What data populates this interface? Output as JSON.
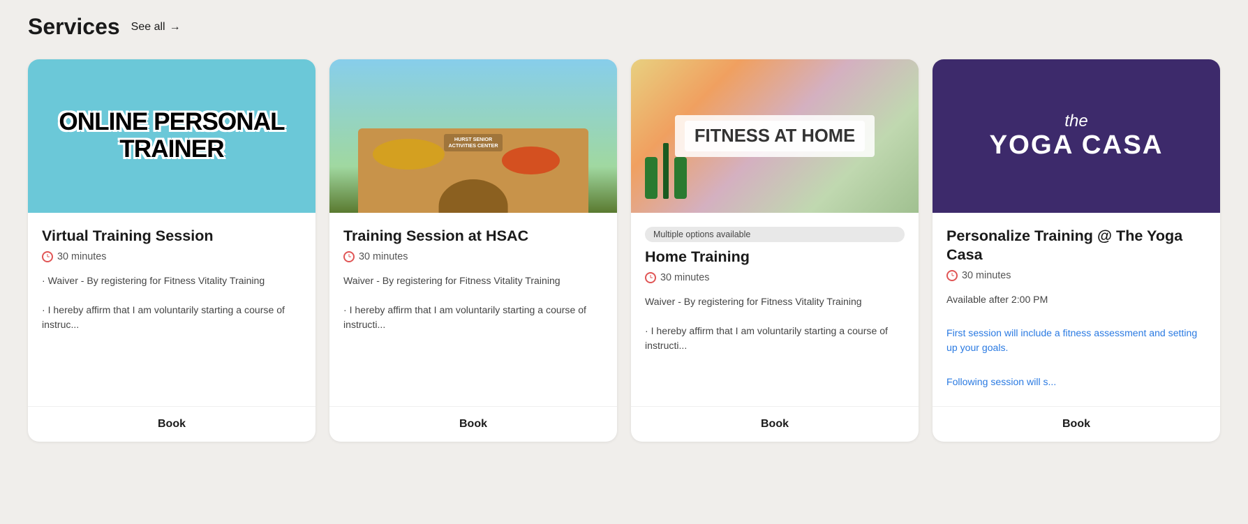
{
  "header": {
    "title": "Services",
    "see_all_label": "See all",
    "arrow": "→"
  },
  "cards": [
    {
      "id": "virtual",
      "image_type": "virtual",
      "image_alt": "Online Personal Trainer graphic",
      "image_label": "ONLINE PERSONAL TRAINER",
      "badge": null,
      "title": "Virtual Training Session",
      "duration": "30 minutes",
      "description_line1": "· Waiver - By registering for Fitness Vitality Training",
      "description_line2": "· I hereby affirm that I am voluntarily starting a course of instruc...",
      "available_note": null,
      "extra_link1": null,
      "extra_link2": null,
      "book_label": "Book"
    },
    {
      "id": "hsac",
      "image_type": "hsac",
      "image_alt": "Hurst Senior Activities Center building",
      "image_label": "",
      "badge": null,
      "title": "Training Session at HSAC",
      "duration": "30 minutes",
      "description_line1": "Waiver - By registering for Fitness Vitality Training",
      "description_line2": "· I hereby affirm that I am voluntarily starting a course of instructi...",
      "available_note": null,
      "extra_link1": null,
      "extra_link2": null,
      "book_label": "Book"
    },
    {
      "id": "home",
      "image_type": "home",
      "image_alt": "Fitness at Home equipment",
      "image_label": "FITNESS AT HOME",
      "badge": "Multiple options available",
      "title": "Home Training",
      "duration": "30 minutes",
      "description_line1": "Waiver - By registering for Fitness Vitality Training",
      "description_line2": "· I hereby affirm that I am voluntarily starting a course of instructi...",
      "available_note": null,
      "extra_link1": null,
      "extra_link2": null,
      "book_label": "Book"
    },
    {
      "id": "yoga",
      "image_type": "yoga",
      "image_alt": "The Yoga Casa sign",
      "image_label_the": "the",
      "image_label_main": "YOGA CASA",
      "badge": null,
      "title": "Personalize Training @ The Yoga Casa",
      "duration": "30 minutes",
      "description_line1": null,
      "description_line2": null,
      "available_note": "Available after 2:00 PM",
      "extra_link1": "First session will include a fitness assessment and setting up your goals.",
      "extra_link2": "Following session will s...",
      "book_label": "Book"
    }
  ]
}
